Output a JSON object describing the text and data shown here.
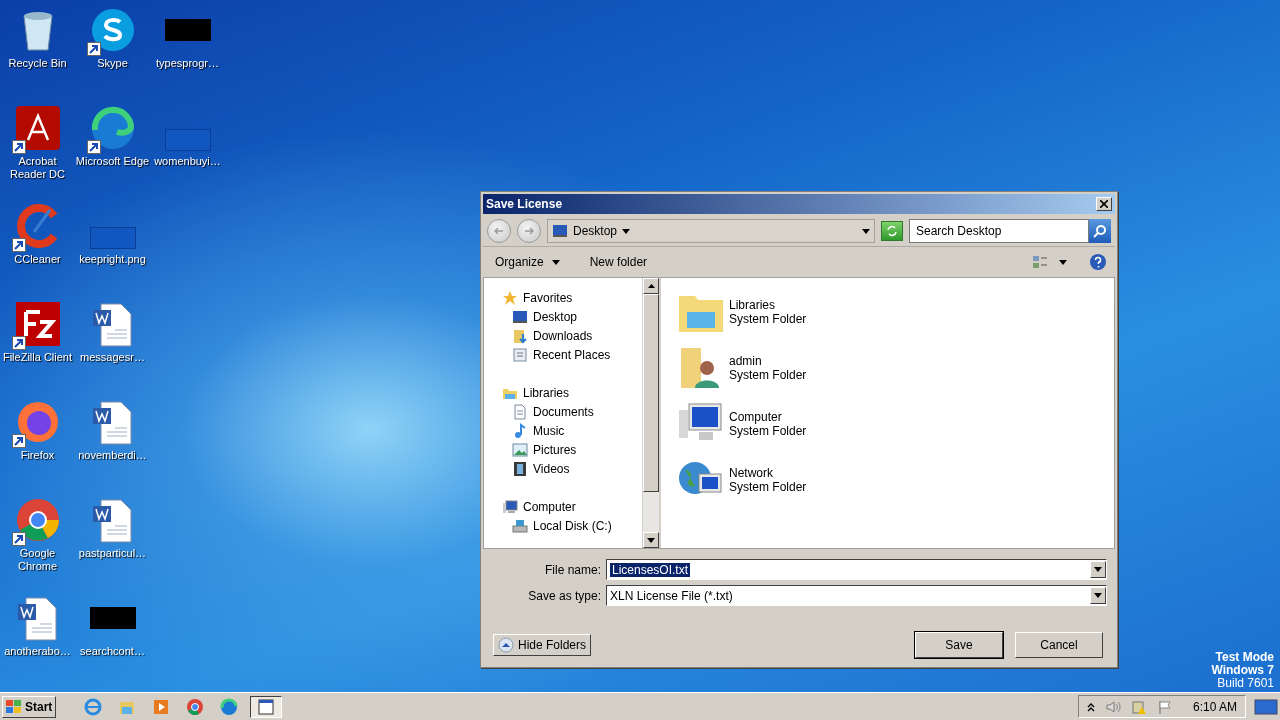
{
  "desktop": {
    "columns": [
      [
        {
          "label": "Recycle Bin",
          "kind": "recycle",
          "shortcut": false
        },
        {
          "label": "Acrobat Reader DC",
          "kind": "acrobat",
          "shortcut": true
        },
        {
          "label": "CCleaner",
          "kind": "ccleaner",
          "shortcut": true
        },
        {
          "label": "FileZilla Client",
          "kind": "filezilla",
          "shortcut": true
        },
        {
          "label": "Firefox",
          "kind": "firefox",
          "shortcut": true
        },
        {
          "label": "Google Chrome",
          "kind": "chrome",
          "shortcut": true
        },
        {
          "label": "anotherabo…",
          "kind": "word",
          "shortcut": false
        }
      ],
      [
        {
          "label": "Skype",
          "kind": "skype",
          "shortcut": true
        },
        {
          "label": "Microsoft Edge",
          "kind": "edge",
          "shortcut": true
        },
        {
          "label": "keepright.png",
          "kind": "blue-thumb",
          "shortcut": false
        },
        {
          "label": "messagesr…",
          "kind": "word",
          "shortcut": false
        },
        {
          "label": "novemberdi…",
          "kind": "word",
          "shortcut": false
        },
        {
          "label": "pastparticul…",
          "kind": "word",
          "shortcut": false
        },
        {
          "label": "searchcont…",
          "kind": "black-thumb",
          "shortcut": false
        }
      ],
      [
        {
          "label": "typesprogr…",
          "kind": "black-thumb",
          "shortcut": false
        },
        {
          "label": "womenbuyi…",
          "kind": "blue-thumb",
          "shortcut": false
        }
      ]
    ],
    "watermark": [
      "Test Mode",
      "Windows 7",
      "Build 7601"
    ]
  },
  "dialog": {
    "title": "Save License",
    "address": "Desktop",
    "search": {
      "placeholder": "Search Desktop"
    },
    "toolbar": [
      {
        "label": "Organize",
        "dropdown": true
      },
      {
        "label": "New folder",
        "dropdown": false
      }
    ],
    "nav": [
      {
        "label": "Favorites",
        "kind": "star",
        "children": [
          {
            "label": "Desktop",
            "kind": "desktop"
          },
          {
            "label": "Downloads",
            "kind": "downloads"
          },
          {
            "label": "Recent Places",
            "kind": "recent"
          }
        ]
      },
      {
        "label": "Libraries",
        "kind": "library",
        "children": [
          {
            "label": "Documents",
            "kind": "document"
          },
          {
            "label": "Music",
            "kind": "music"
          },
          {
            "label": "Pictures",
            "kind": "pictures"
          },
          {
            "label": "Videos",
            "kind": "videos"
          }
        ]
      },
      {
        "label": "Computer",
        "kind": "computer",
        "children": [
          {
            "label": "Local Disk (C:)",
            "kind": "disk"
          }
        ]
      }
    ],
    "items": [
      {
        "name": "Libraries",
        "type": "System Folder",
        "kind": "libraries"
      },
      {
        "name": "admin",
        "type": "System Folder",
        "kind": "user"
      },
      {
        "name": "Computer",
        "type": "System Folder",
        "kind": "computer"
      },
      {
        "name": "Network",
        "type": "System Folder",
        "kind": "network"
      }
    ],
    "file_name": {
      "label": "File name:",
      "value": "LicensesOI.txt",
      "text_selected": true
    },
    "save_type": {
      "label": "Save as type:",
      "value": "XLN License File (*.txt)"
    },
    "hide_folders": "Hide Folders",
    "buttons": [
      {
        "label": "Save",
        "default": true
      },
      {
        "label": "Cancel",
        "default": false
      }
    ]
  },
  "taskbar": {
    "start": "Start",
    "apps": [
      {
        "kind": "ie",
        "selected": false
      },
      {
        "kind": "explorer",
        "selected": false
      },
      {
        "kind": "media",
        "selected": false
      },
      {
        "kind": "chrome",
        "selected": false
      },
      {
        "kind": "edge",
        "selected": false
      },
      {
        "kind": "window",
        "selected": true
      }
    ],
    "clock": "6:10 AM"
  }
}
